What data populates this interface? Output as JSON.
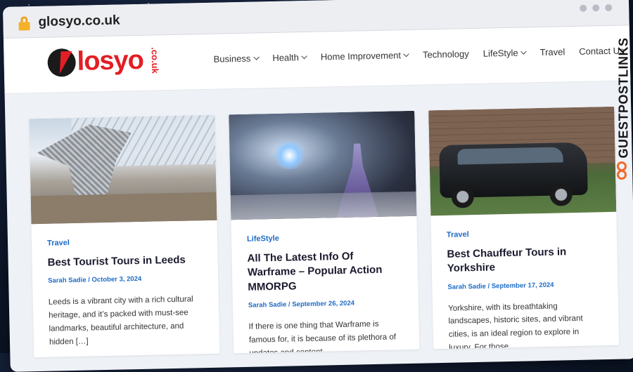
{
  "browser": {
    "url": "glosyo.co.uk"
  },
  "site": {
    "logo_text": "losyo",
    "logo_tld": ".co.uk",
    "nav": [
      {
        "label": "Business",
        "has_dropdown": true
      },
      {
        "label": "Health",
        "has_dropdown": true
      },
      {
        "label": "Home Improvement",
        "has_dropdown": true
      },
      {
        "label": "Technology",
        "has_dropdown": false
      },
      {
        "label": "LifeStyle",
        "has_dropdown": true
      },
      {
        "label": "Travel",
        "has_dropdown": false
      },
      {
        "label": "Contact Us",
        "has_dropdown": false
      }
    ]
  },
  "posts": [
    {
      "category": "Travel",
      "title": "Best Tourist Tours in Leeds",
      "meta": "Sarah Sadie / October 3, 2024",
      "excerpt": "Leeds is a vibrant city with a rich cultural heritage, and it’s packed with must-see landmarks, beautiful architecture, and hidden […]"
    },
    {
      "category": "LifeStyle",
      "title": "All The Latest Info Of Warframe – Popular Action MMORPG",
      "meta": "Sarah Sadie / September 26, 2024",
      "excerpt": "If there is one thing that Warframe is famous for, it is because of its plethora of updates and content"
    },
    {
      "category": "Travel",
      "title": "Best Chauffeur Tours in Yorkshire",
      "meta": "Sarah Sadie / September 17, 2024",
      "excerpt": "Yorkshire, with its breathtaking landscapes, historic sites, and vibrant cities, is an ideal region to explore in luxury. For those"
    }
  ],
  "side_banner": {
    "text": "GUESTPOSTLINKS",
    "accent": "#f26b2a"
  }
}
